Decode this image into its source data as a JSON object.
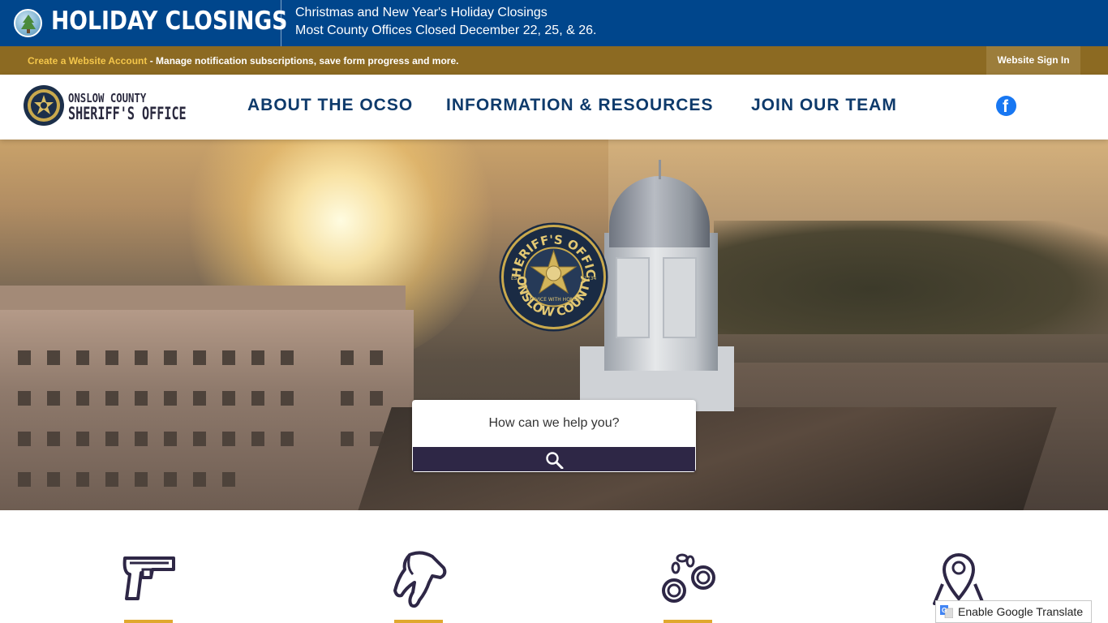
{
  "alert": {
    "title": "HOLIDAY CLOSINGS",
    "line1": "Christmas and New Year's Holiday Closings",
    "line2": "Most County Offices Closed December 22, 25, & 26."
  },
  "account_bar": {
    "create_link": "Create a Website Account",
    "description": " - Manage notification subscriptions, save form progress and more.",
    "sign_in": "Website Sign In"
  },
  "header": {
    "logo_line1": "ONSLOW COUNTY",
    "logo_line2": "SHERIFF'S OFFICE",
    "nav": [
      "ABOUT THE OCSO",
      "INFORMATION & RESOURCES",
      "JOIN OUR TEAM"
    ],
    "social_icon": "facebook-icon"
  },
  "hero": {
    "seal_text_top": "SHERIFF'S OFFICE",
    "seal_text_bottom": "ONSLOW COUNTY",
    "seal_est": "EST.",
    "seal_year": "1734",
    "seal_motto": "SERVICE WITH HONOR",
    "search_placeholder": "How can we help you?"
  },
  "quick_links": {
    "icons": [
      "handgun-icon",
      "k9-dog-icon",
      "handcuffs-icon",
      "map-pin-icon"
    ],
    "accent": "#e0a82e"
  },
  "translate": {
    "label": "Enable Google Translate"
  },
  "colors": {
    "alert_bg": "#00468c",
    "account_bg": "#8c6a22",
    "nav_text": "#0e3a6b",
    "search_button": "#2e2746"
  }
}
